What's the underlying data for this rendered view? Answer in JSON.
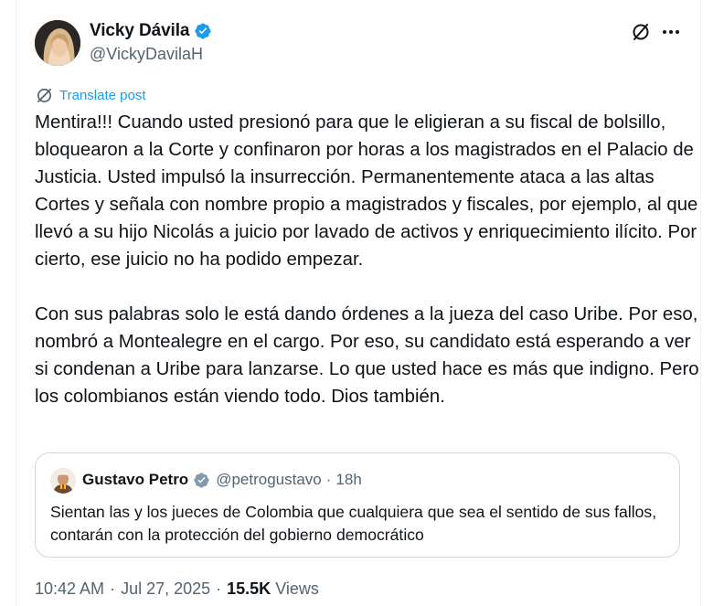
{
  "author": {
    "display_name": "Vicky Dávila",
    "handle": "@VickyDavilaH",
    "verified_color": "#1d9bf0"
  },
  "header_icons": [
    "grok-icon",
    "more-options-icon"
  ],
  "translate": {
    "label": "Translate post",
    "icon": "translate-globe-icon",
    "color": "#1d9bf0"
  },
  "tweet": {
    "text": "Mentira!!! Cuando usted presionó para que le eligieran a su fiscal de bolsillo, bloquearon a la Corte y confinaron por horas a los magistrados en el Palacio de Justicia. Usted impulsó la insurrección. Permanentemente ataca a las altas Cortes y señala con nombre propio a magistrados y fiscales, por ejemplo, al que llevó a su hijo Nicolás a juicio por lavado de activos y enriquecimiento ilícito. Por cierto, ese juicio no ha podido empezar.\n\nCon sus palabras solo le está dando órdenes a la jueza del caso Uribe. Por eso, nombró a Montealegre en el cargo. Por eso, su candidato está esperando a ver si condenan a Uribe para lanzarse. Lo que usted hace es más que indigno. Pero los colombianos están viendo todo. Dios también."
  },
  "quote": {
    "display_name": "Gustavo Petro",
    "badge_color": "#829aab",
    "handle": "@petrogustavo",
    "separator": "·",
    "time": "18h",
    "text": "Sientan las y los jueces de Colombia que cualquiera que sea el sentido de sus fallos, contarán con la protección del gobierno democrático"
  },
  "meta": {
    "time": "10:42 AM",
    "separator": "·",
    "date": "Jul 27, 2025",
    "views_count": "15.5K",
    "views_label": "Views"
  }
}
